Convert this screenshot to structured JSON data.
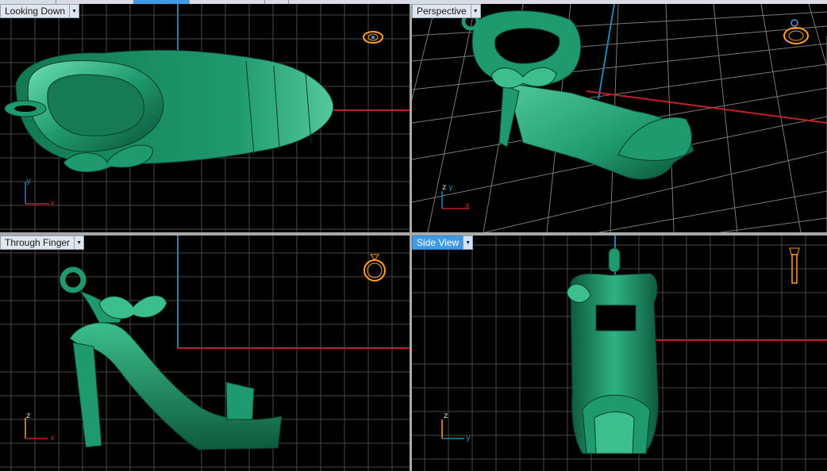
{
  "viewports": {
    "top_left": {
      "title": "Looking Down",
      "axis_a": "y",
      "axis_b": "x"
    },
    "top_right": {
      "title": "Perspective",
      "axis_a": "z",
      "axis_b": "y",
      "axis_c": "x"
    },
    "bottom_left": {
      "title": "Through Finger",
      "axis_a": "z",
      "axis_b": "x"
    },
    "bottom_right": {
      "title": "Side View",
      "axis_a": "z",
      "axis_b": "y"
    }
  },
  "active_viewport": "Side View",
  "colors": {
    "model": "#1f9a6e",
    "model_light": "#5fd1a4",
    "model_dark": "#0d5a3d",
    "grid": "#4a4a4a",
    "x_axis": "#c0202a",
    "y_axis": "#1c86b8",
    "gizmo": "#ffa020"
  },
  "icons": {
    "dropdown": "chevron-down-icon",
    "gizmo": "ring-icon"
  }
}
